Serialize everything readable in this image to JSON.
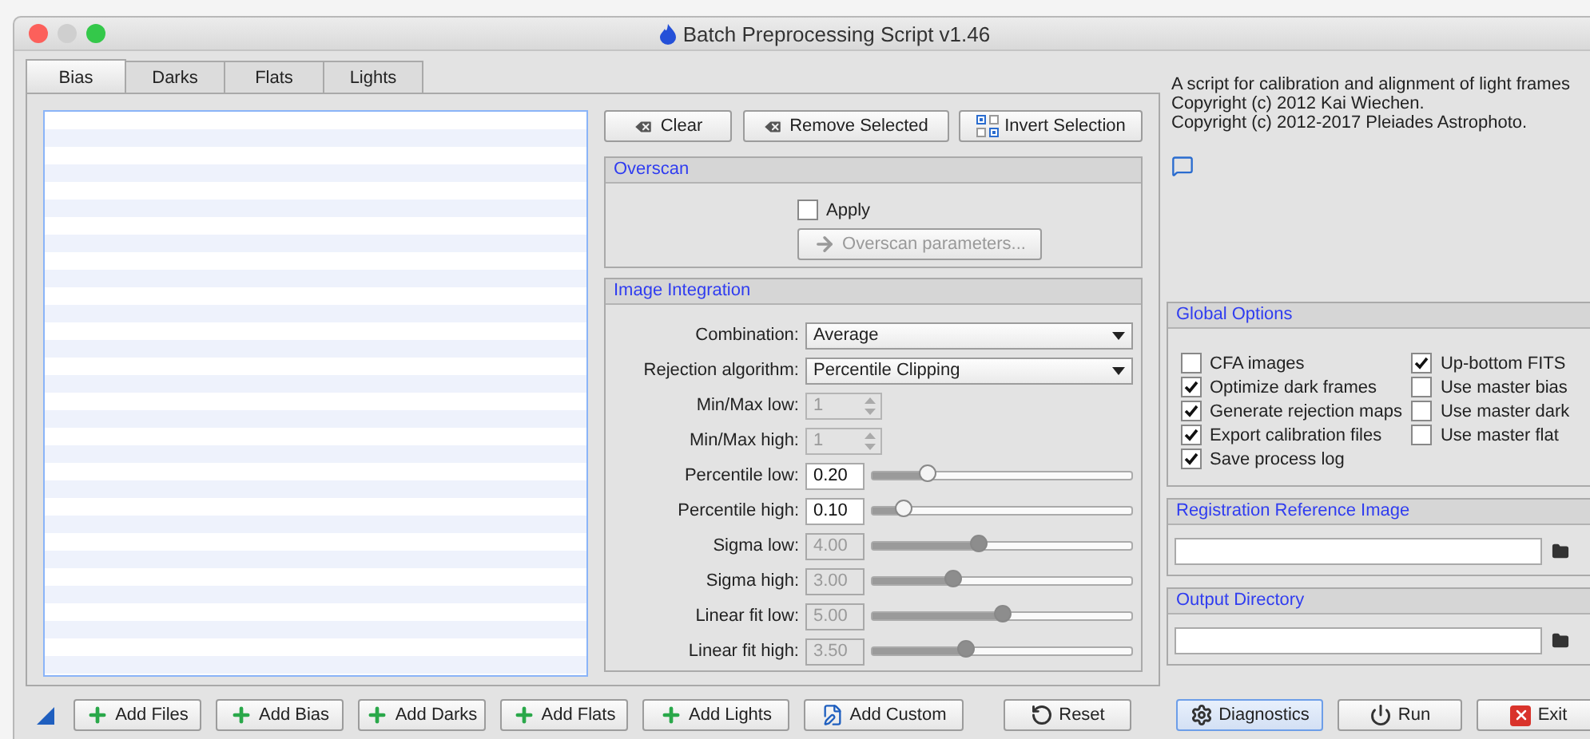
{
  "window": {
    "title": "Batch Preprocessing Script v1.46"
  },
  "tabs": [
    {
      "label": "Bias",
      "selected": true
    },
    {
      "label": "Darks",
      "selected": false
    },
    {
      "label": "Flats",
      "selected": false
    },
    {
      "label": "Lights",
      "selected": false
    }
  ],
  "list_actions": [
    {
      "label": "Clear"
    },
    {
      "label": "Remove Selected"
    },
    {
      "label": "Invert Selection"
    }
  ],
  "overscan": {
    "title": "Overscan",
    "apply": {
      "label": "Apply",
      "checked": false
    },
    "parameters_button": {
      "label": "Overscan parameters...",
      "disabled": true
    }
  },
  "image_integration": {
    "title": "Image Integration",
    "rows": [
      {
        "kind": "combo",
        "label": "Combination:",
        "value": "Average"
      },
      {
        "kind": "combo",
        "label": "Rejection algorithm:",
        "value": "Percentile Clipping"
      },
      {
        "kind": "spin",
        "label": "Min/Max low:",
        "value": "1",
        "disabled": true
      },
      {
        "kind": "spin",
        "label": "Min/Max high:",
        "value": "1",
        "disabled": true
      },
      {
        "kind": "slider",
        "label": "Percentile low:",
        "value": "0.20",
        "disabled": false,
        "level": 0.21
      },
      {
        "kind": "slider",
        "label": "Percentile high:",
        "value": "0.10",
        "disabled": false,
        "level": 0.12
      },
      {
        "kind": "slider",
        "label": "Sigma low:",
        "value": "4.00",
        "disabled": true,
        "level": 0.41
      },
      {
        "kind": "slider",
        "label": "Sigma high:",
        "value": "3.00",
        "disabled": true,
        "level": 0.31
      },
      {
        "kind": "slider",
        "label": "Linear fit low:",
        "value": "5.00",
        "disabled": true,
        "level": 0.5
      },
      {
        "kind": "slider",
        "label": "Linear fit high:",
        "value": "3.50",
        "disabled": true,
        "level": 0.36
      }
    ]
  },
  "about": {
    "lines": [
      "A script for calibration and alignment of light frames",
      "Copyright (c) 2012 Kai Wiechen.",
      "Copyright (c) 2012-2017 Pleiades Astrophoto."
    ]
  },
  "global_options": {
    "title": "Global Options",
    "columns": [
      [
        {
          "label": "CFA images",
          "checked": false
        },
        {
          "label": "Optimize dark frames",
          "checked": true
        },
        {
          "label": "Generate rejection maps",
          "checked": true
        },
        {
          "label": "Export calibration files",
          "checked": true
        },
        {
          "label": "Save process log",
          "checked": true
        }
      ],
      [
        {
          "label": "Up-bottom FITS",
          "checked": true
        },
        {
          "label": "Use master bias",
          "checked": false
        },
        {
          "label": "Use master dark",
          "checked": false
        },
        {
          "label": "Use master flat",
          "checked": false
        }
      ]
    ]
  },
  "registration_reference": {
    "title": "Registration Reference Image"
  },
  "output_directory": {
    "title": "Output Directory"
  },
  "add_buttons": [
    {
      "label": "Add Files"
    },
    {
      "label": "Add Bias"
    },
    {
      "label": "Add Darks"
    },
    {
      "label": "Add Flats"
    },
    {
      "label": "Add Lights"
    },
    {
      "label": "Add Custom"
    }
  ],
  "reset_button": {
    "label": "Reset",
    "focused": false
  },
  "dialog_buttons": [
    {
      "label": "Diagnostics",
      "focused": true
    },
    {
      "label": "Run",
      "focused": false
    },
    {
      "label": "Exit",
      "focused": false
    }
  ]
}
